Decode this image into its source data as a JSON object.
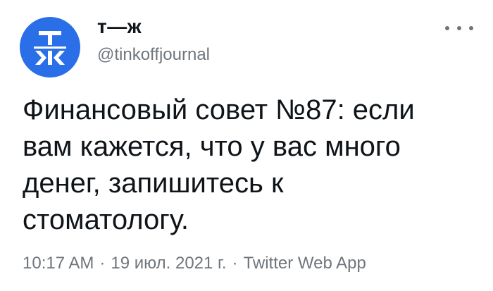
{
  "author": {
    "display_name": "т—ж",
    "handle": "@tinkoffjournal",
    "avatar_text_top": "Т",
    "avatar_text_bottom": "Ж",
    "avatar_color": "#2b6fe8"
  },
  "menu": {
    "icon": "more-horizontal-icon"
  },
  "tweet": {
    "text": "Финансовый совет №87: если\nвам кажется, что у вас много\nденег, запишитесь к\nстоматологу."
  },
  "meta": {
    "time": "10:17 AM",
    "separator": "·",
    "date": "19 июл. 2021 г.",
    "source": "Twitter Web App"
  },
  "colors": {
    "text": "#0f1419",
    "secondary": "#6e767d"
  }
}
